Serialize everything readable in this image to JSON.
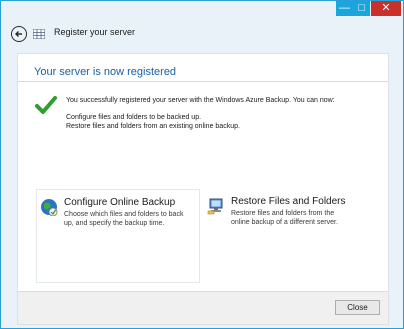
{
  "window": {
    "minimize_glyph": "—",
    "maximize_glyph": "□",
    "close_glyph": "✕",
    "title": "Register your server"
  },
  "main": {
    "heading": "Your server is now registered",
    "message": "You successfully registered your server with the Windows Azure Backup. You can now:",
    "items": [
      "Configure files and folders to be backed up.",
      "Restore files and folders from an existing online backup."
    ]
  },
  "options": [
    {
      "title": "Configure Online Backup",
      "description_lines": [
        "Choose which files and folders to back",
        "up, and specify the backup time."
      ],
      "icon": "globe-backup-icon"
    },
    {
      "title": "Restore Files and Folders",
      "description_lines": [
        "Restore files and folders from the",
        "online backup of a different server."
      ],
      "icon": "computer-restore-icon"
    }
  ],
  "footer": {
    "close_label": "Close"
  },
  "colors": {
    "accent": "#1b5fa8",
    "check": "#2e9e2e",
    "close_button": "#c9302c",
    "caption_buttons": "#1aa5dd"
  }
}
